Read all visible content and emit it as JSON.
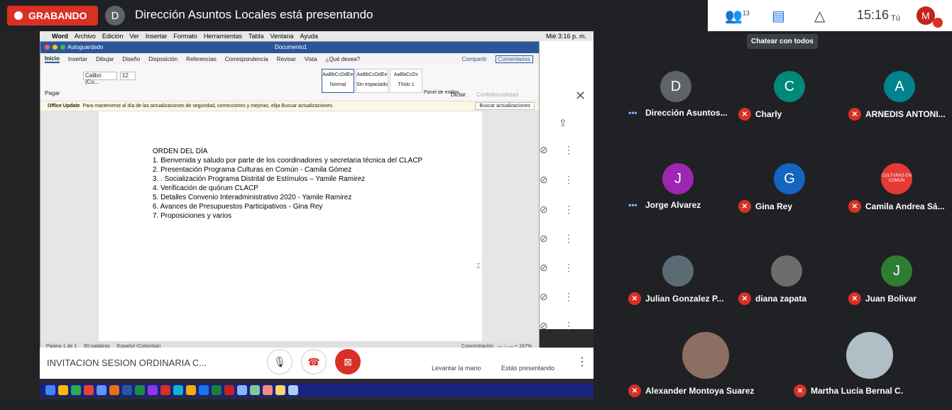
{
  "recording": {
    "label": "GRABANDO"
  },
  "presenter": {
    "initial": "D",
    "title": "Dirección Asuntos Locales está presentando"
  },
  "topbar": {
    "people_count": "13",
    "time": "15:16",
    "self_label": "Tú",
    "self_initial": "M"
  },
  "tooltip": "Chatear con todos",
  "mac_menu": {
    "app": "Word",
    "items": [
      "Archivo",
      "Edición",
      "Ver",
      "Insertar",
      "Formato",
      "Herramientas",
      "Tabla",
      "Ventana",
      "Ayuda"
    ],
    "clock": "Mié 3:16 p. m."
  },
  "word": {
    "autosave": "Autoguardado",
    "doc_title": "Documento1",
    "tabs": [
      "Inicio",
      "Insertar",
      "Dibujar",
      "Diseño",
      "Disposición",
      "Referencias",
      "Correspondencia",
      "Revisar",
      "Vista"
    ],
    "tell_me": "¿Qué desea?",
    "share": "Compartir",
    "comments": "Comentarios",
    "font": "Calibri (Cu...",
    "size": "12",
    "paste": "Pegar",
    "styles": [
      {
        "sample": "AaBbCcDdEe",
        "name": "Normal"
      },
      {
        "sample": "AaBbCcDdEe",
        "name": "Sin espaciado"
      },
      {
        "sample": "AaBbCcDc",
        "name": "Título 1"
      }
    ],
    "styles_pane": "Panel de estilos",
    "dictate": "Dictar",
    "sensitivity": "Confidencialidad",
    "update_title": "Office Update",
    "update_text": "Para mantenerse al día de las actualizaciones de seguridad, correcciones y mejoras, elija Buscar actualizaciones.",
    "update_button": "Buscar actualizaciones",
    "document_lines": [
      "ORDEN DEL DÍA",
      "1. Bienvenida y saludo por parte de los coordinadores y secretaria técnica del CLACP",
      "2. Presentación Programa Culturas en Común - Camila Gómez",
      "3. . Socialización Programa Distrital de Estímulos – Yamile Ramirez",
      "4. Verificación de quórum CLACP",
      "5. Detalles Convenio Interadministrativo 2020 - Yamile Ramirez",
      "6. Avances de Presupuestos Participativos - Gina Rey",
      "7. Proposiciones y varios"
    ],
    "status": {
      "page": "Página 1 de 1",
      "words": "60 palabras",
      "lang": "Español (Colombia)",
      "focus": "Concentración",
      "zoom": "167%"
    }
  },
  "meet": {
    "title": "INVITACION SESION ORDINARIA C...",
    "raise_hand": "Levantar la mano",
    "presenting": "Estás presentando"
  },
  "participants": [
    {
      "name": "Dirección Asuntos...",
      "initial": "D",
      "color": "#5f6368",
      "state": "talking"
    },
    {
      "name": "Charly",
      "initial": "C",
      "color": "#00897b",
      "state": "muted"
    },
    {
      "name": "ARNEDIS ANTONI...",
      "initial": "A",
      "color": "#00838f",
      "state": "muted"
    },
    {
      "name": "Jorge Alvarez",
      "initial": "J",
      "color": "#9c27b0",
      "state": "talking"
    },
    {
      "name": "Gina Rey",
      "initial": "G",
      "color": "#1565c0",
      "state": "muted"
    },
    {
      "name": "Camila Andrea Sá...",
      "initial": "",
      "color": "#e53935",
      "state": "muted",
      "logo_text": "CULTURAS EN COMÚN"
    },
    {
      "name": "Julian Gonzalez P...",
      "initial": "",
      "color": "#5a6b73",
      "state": "muted",
      "photo": true
    },
    {
      "name": "diana zapata",
      "initial": "",
      "color": "#6d6d6d",
      "state": "muted",
      "photo": true
    },
    {
      "name": "Juan Bolivar",
      "initial": "J",
      "color": "#2e7d32",
      "state": "muted"
    },
    {
      "name": "Alexander Montoya Suarez",
      "initial": "",
      "color": "#8d6e63",
      "state": "muted",
      "photo": true
    },
    {
      "name": "Martha Lucía Bernal C.",
      "initial": "",
      "color": "#b0bec5",
      "state": "muted",
      "photo": true
    }
  ]
}
